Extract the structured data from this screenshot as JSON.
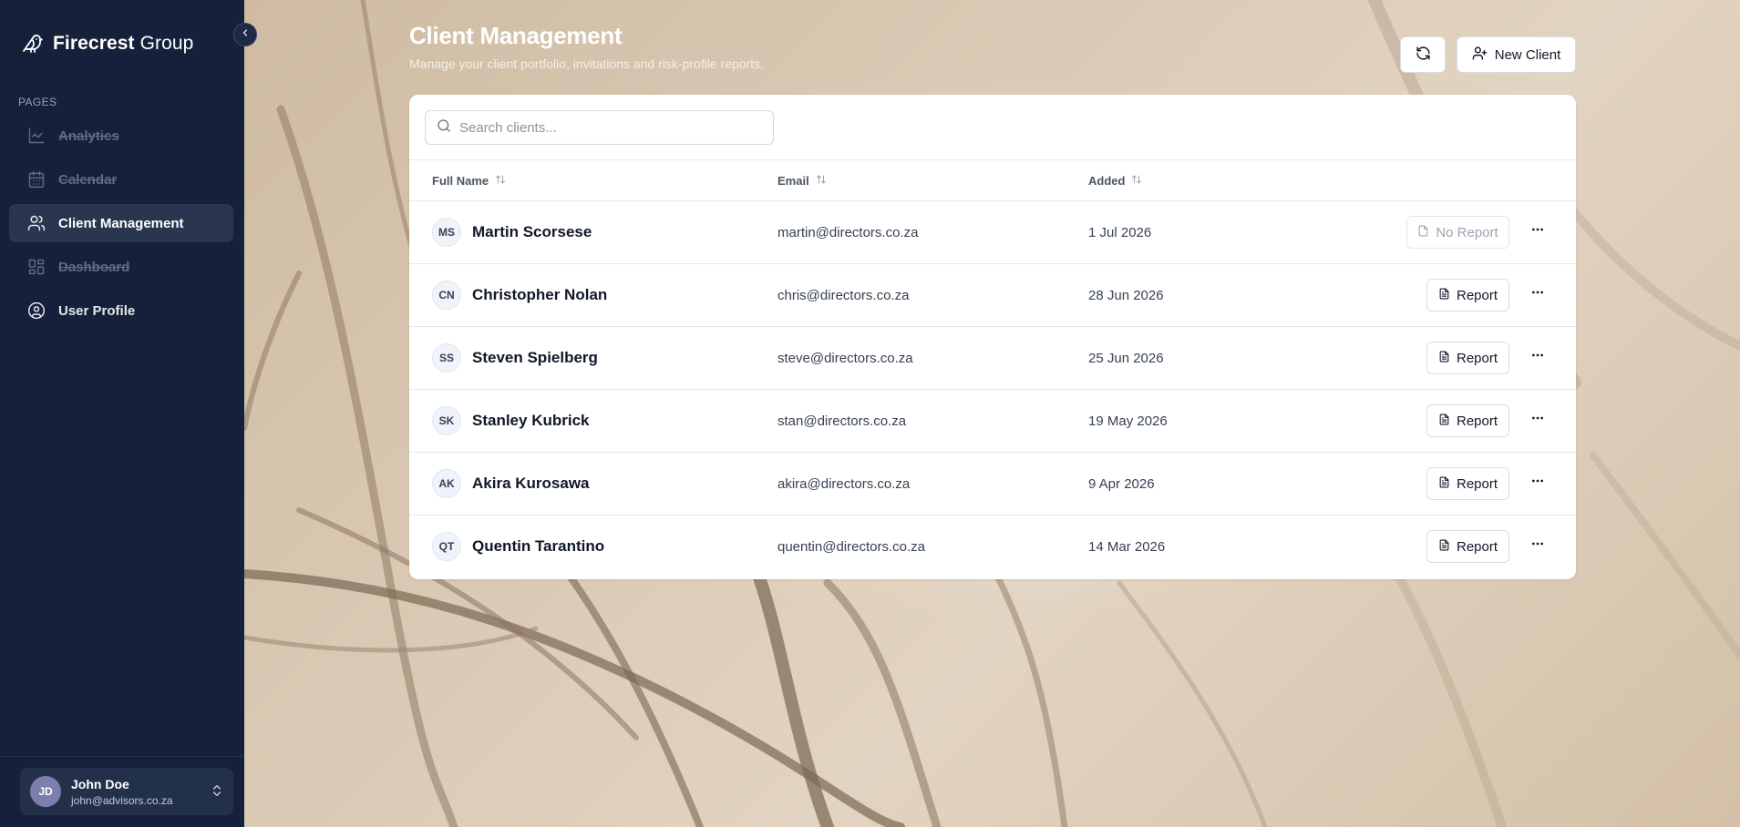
{
  "brand": {
    "name_bold": "Firecrest",
    "name_regular": "Group"
  },
  "sidebar": {
    "section_label": "PAGES",
    "items": [
      {
        "label": "Analytics",
        "icon": "line-chart-icon",
        "state": "disabled"
      },
      {
        "label": "Calendar",
        "icon": "calendar-icon",
        "state": "disabled"
      },
      {
        "label": "Client Management",
        "icon": "users-icon",
        "state": "active"
      },
      {
        "label": "Dashboard",
        "icon": "dashboard-icon",
        "state": "disabled"
      },
      {
        "label": "User Profile",
        "icon": "user-circle-icon",
        "state": "normal"
      }
    ],
    "user": {
      "initials": "JD",
      "name": "John Doe",
      "email": "john@advisors.co.za"
    }
  },
  "header": {
    "title": "Client Management",
    "subtitle": "Manage your client portfolio, invitations and risk-profile reports.",
    "refresh_icon": "refresh-icon",
    "new_client_label": "New Client"
  },
  "search": {
    "placeholder": "Search clients...",
    "value": ""
  },
  "table": {
    "columns": [
      "Full Name",
      "Email",
      "Added"
    ],
    "rows": [
      {
        "initials": "MS",
        "name": "Martin Scorsese",
        "email": "martin@directors.co.za",
        "added": "1 Jul 2026",
        "report_label": "No Report",
        "has_report": false
      },
      {
        "initials": "CN",
        "name": "Christopher Nolan",
        "email": "chris@directors.co.za",
        "added": "28 Jun 2026",
        "report_label": "Report",
        "has_report": true
      },
      {
        "initials": "SS",
        "name": "Steven Spielberg",
        "email": "steve@directors.co.za",
        "added": "25 Jun 2026",
        "report_label": "Report",
        "has_report": true
      },
      {
        "initials": "SK",
        "name": "Stanley Kubrick",
        "email": "stan@directors.co.za",
        "added": "19 May 2026",
        "report_label": "Report",
        "has_report": true
      },
      {
        "initials": "AK",
        "name": "Akira Kurosawa",
        "email": "akira@directors.co.za",
        "added": "9 Apr 2026",
        "report_label": "Report",
        "has_report": true
      },
      {
        "initials": "QT",
        "name": "Quentin Tarantino",
        "email": "quentin@directors.co.za",
        "added": "14 Mar 2026",
        "report_label": "Report",
        "has_report": true
      }
    ]
  },
  "colors": {
    "sidebar_bg": "#15213a",
    "active_item_bg": "#2a3650",
    "card_bg": "#ffffff"
  }
}
